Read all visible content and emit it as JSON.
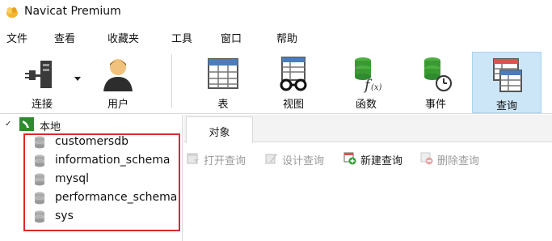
{
  "window": {
    "title": "Navicat Premium"
  },
  "menu": [
    "文件",
    "查看",
    "收藏夹",
    "工具",
    "窗口",
    "帮助"
  ],
  "toolbar": {
    "buttons": [
      {
        "label": "连接",
        "icon": "connection-icon"
      },
      {
        "label": "用户",
        "icon": "user-icon"
      },
      {
        "label": "表",
        "icon": "table-icon"
      },
      {
        "label": "视图",
        "icon": "view-icon"
      },
      {
        "label": "函数",
        "icon": "function-icon"
      },
      {
        "label": "事件",
        "icon": "event-icon"
      },
      {
        "label": "查询",
        "icon": "query-icon",
        "active": true
      }
    ]
  },
  "tree": {
    "root_label": "本地",
    "databases": [
      "customersdb",
      "information_schema",
      "mysql",
      "performance_schema",
      "sys"
    ]
  },
  "tabs": [
    {
      "label": "对象"
    }
  ],
  "object_toolbar": {
    "open_query": "打开查询",
    "design_query": "设计查询",
    "new_query": "新建查询",
    "delete_query": "删除查询"
  },
  "colors": {
    "highlight_border": "#e0262b",
    "active_button_bg": "#cde6f7",
    "db_icon": "#a9a9a9",
    "accent_green": "#2e8b2e"
  }
}
